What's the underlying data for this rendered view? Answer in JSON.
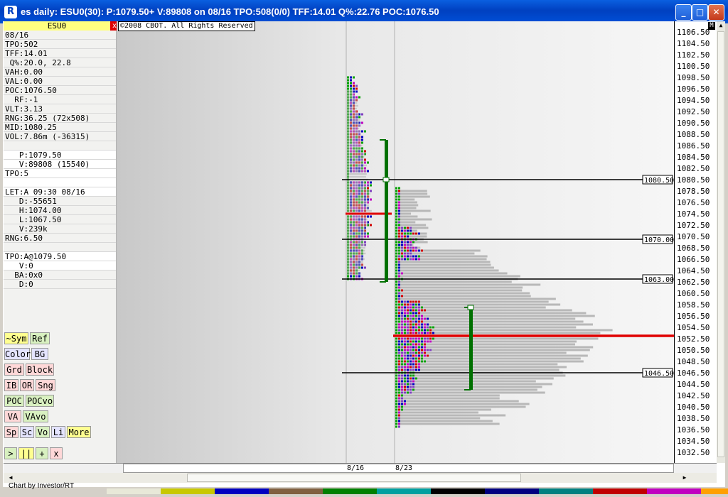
{
  "window": {
    "title": "es daily: ESU0(30): P:1079.50+ V:89808 on 08/16 TPO:508(0/0) TFF:14.01 Q%:22.76 POC:1076.50",
    "app_icon": "R",
    "minimize": "_",
    "maximize": "□",
    "close": "✕"
  },
  "sidebar": {
    "symbol": "ESU0",
    "close_x": "x",
    "rows": [
      {
        "text": "08/16",
        "white": false
      },
      {
        "text": "TPO:502",
        "white": false
      },
      {
        "text": "TFF:14.01",
        "white": false
      },
      {
        "text": " Q%:20.0, 22.8",
        "white": false
      },
      {
        "text": "VAH:0.00",
        "white": false
      },
      {
        "text": "VAL:0.00",
        "white": false
      },
      {
        "text": "POC:1076.50",
        "white": false
      },
      {
        "text": "  RF:-1",
        "white": false
      },
      {
        "text": "VLT:3.13",
        "white": false
      },
      {
        "text": "RNG:36.25 (72x508)",
        "white": false
      },
      {
        "text": "MID:1080.25",
        "white": false
      },
      {
        "text": "VOL:7.86m (-36315)",
        "white": false
      },
      {
        "text": "",
        "white": false
      },
      {
        "text": "   P:1079.50",
        "white": true
      },
      {
        "text": "   V:89808 (15540)",
        "white": true
      },
      {
        "text": "TPO:5",
        "white": true
      },
      {
        "text": "",
        "white": true
      },
      {
        "text": "LET:A 09:30 08/16",
        "white": true
      },
      {
        "text": "   D:-55651",
        "white": false
      },
      {
        "text": "   H:1074.00",
        "white": false
      },
      {
        "text": "   L:1067.50",
        "white": false
      },
      {
        "text": "   V:239k",
        "white": false
      },
      {
        "text": "RNG:6.50",
        "white": false
      },
      {
        "text": "",
        "white": false
      },
      {
        "text": "TPO:A@1079.50",
        "white": true
      },
      {
        "text": "   V:0",
        "white": true
      },
      {
        "text": "  BA:0x0",
        "white": false
      },
      {
        "text": "   D:0",
        "white": false
      }
    ],
    "buttons": [
      {
        "label": "~Sym",
        "bg": "#ffff90"
      },
      {
        "label": "Ref",
        "bg": "#d8f0c0"
      },
      {
        "label": "Color",
        "bg": "#e4e4ff"
      },
      {
        "label": "BG",
        "bg": "#e4e4ff"
      },
      {
        "label": "Grd",
        "bg": "#ffd8d8"
      },
      {
        "label": "Block",
        "bg": "#ffd8d8"
      },
      {
        "label": "IB",
        "bg": "#ffd8d8"
      },
      {
        "label": "OR",
        "bg": "#ffd8d8"
      },
      {
        "label": "Sng",
        "bg": "#ffd8d8"
      },
      {
        "label": "POC",
        "bg": "#d8f0c0"
      },
      {
        "label": "POCvo",
        "bg": "#d8f0c0"
      },
      {
        "label": "VA",
        "bg": "#ffd8d8"
      },
      {
        "label": "VAvo",
        "bg": "#d8f0c0"
      },
      {
        "label": "Sp",
        "bg": "#ffd8d8"
      },
      {
        "label": "Sc",
        "bg": "#e4e4ff"
      },
      {
        "label": "Vo",
        "bg": "#d8f0c0"
      },
      {
        "label": "Li",
        "bg": "#e4e4ff"
      },
      {
        "label": "More",
        "bg": "#ffff90"
      },
      {
        "label": ">",
        "bg": "#d8f0c0"
      },
      {
        "label": "||",
        "bg": "#ffff90"
      },
      {
        "label": "+",
        "bg": "#d8f0c0"
      },
      {
        "label": "x",
        "bg": "#ffd8d8"
      }
    ]
  },
  "chart": {
    "copyright": "©2008 CBOT. All Rights Reserved",
    "corner_label": "M",
    "date_labels": [
      "8/16",
      "8/23"
    ],
    "y_ticks": [
      "1106.50",
      "1104.50",
      "1102.50",
      "1100.50",
      "1098.50",
      "1096.50",
      "1094.50",
      "1092.50",
      "1090.50",
      "1088.50",
      "1086.50",
      "1084.50",
      "1082.50",
      "1080.50",
      "1078.50",
      "1076.50",
      "1074.50",
      "1072.50",
      "1070.50",
      "1068.50",
      "1066.50",
      "1064.50",
      "1062.50",
      "1060.50",
      "1058.50",
      "1056.50",
      "1054.50",
      "1052.50",
      "1050.50",
      "1048.50",
      "1046.50",
      "1044.50",
      "1042.50",
      "1040.50",
      "1038.50",
      "1036.50",
      "1034.50",
      "1032.50"
    ],
    "level_lines": [
      {
        "label": "1080.50",
        "price": 1080.5
      },
      {
        "label": "1070.00",
        "price": 1070.0
      },
      {
        "label": "1063.00",
        "price": 1063.0
      },
      {
        "label": "1046.50",
        "price": 1046.5
      }
    ],
    "poc_price": 1053.0,
    "colors": {
      "poc": "#e00000",
      "range_bar": "#007000",
      "tpo_palette": [
        "#00a000",
        "#d00000",
        "#0000c0",
        "#8040c0",
        "#c000c0",
        "#000000"
      ]
    }
  },
  "chart_data": {
    "type": "table",
    "title": "",
    "ylim": [
      1031.5,
      1107.5
    ],
    "profiles": [
      {
        "date": "8/16",
        "high": 1098.5,
        "low": 1063.0,
        "poc": 1076.5
      },
      {
        "date": "8/23",
        "high": 1079.0,
        "low": 1037.0,
        "poc": 1053.0
      }
    ],
    "range_bars": [
      {
        "high": 1087.5,
        "low": 1062.5
      },
      {
        "high": 1058.0,
        "low": 1043.5
      }
    ],
    "reference_levels": [
      1080.5,
      1070.0,
      1063.0,
      1046.5
    ]
  },
  "footer": {
    "credit": "Chart by Investor/RT"
  }
}
